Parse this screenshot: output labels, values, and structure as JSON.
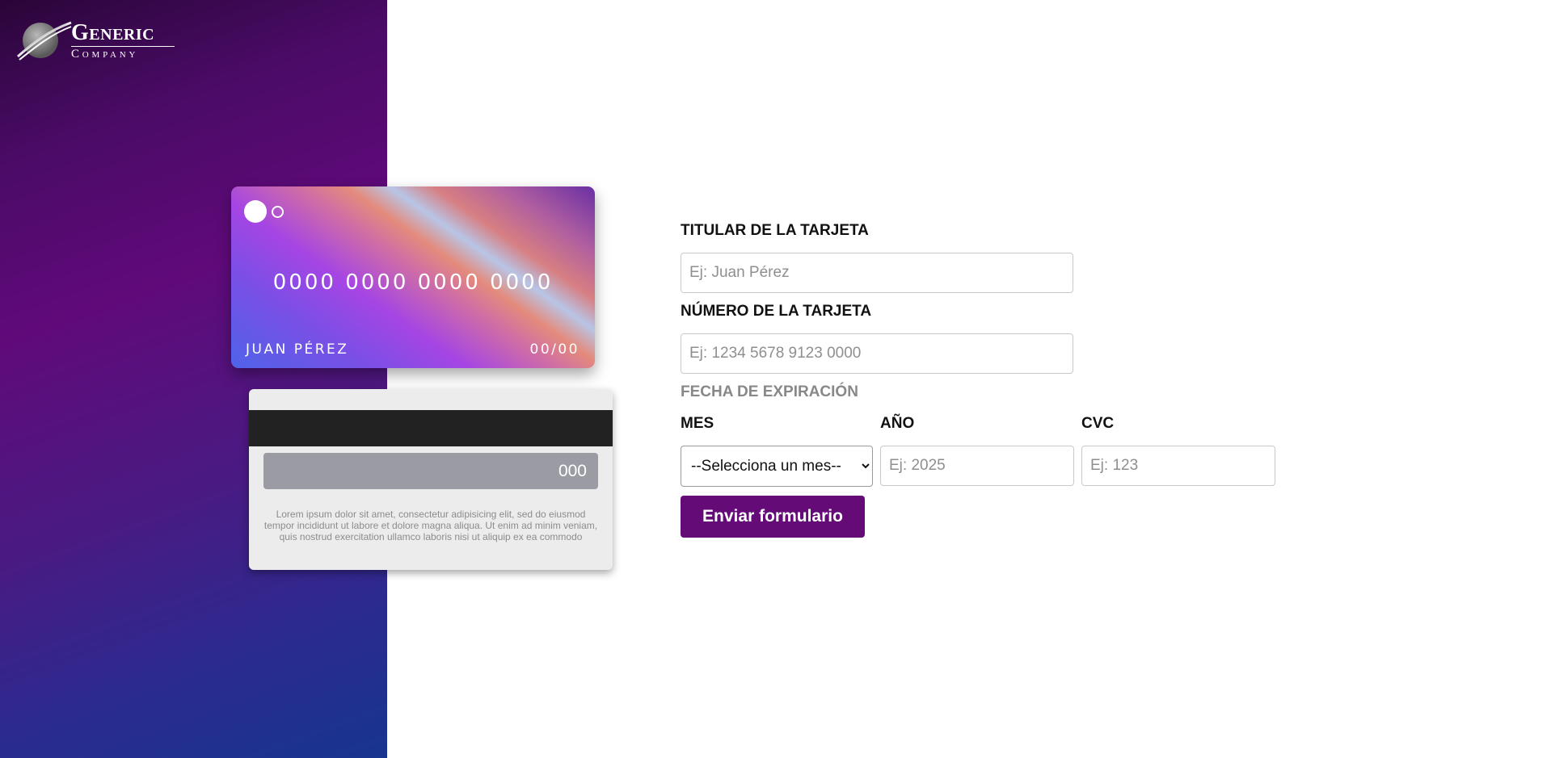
{
  "brand": {
    "logo_line1": "Generic",
    "logo_line2": "Company"
  },
  "card_front": {
    "number": "0000 0000 0000 0000",
    "holder": "JUAN PÉREZ",
    "expiry": "00/00"
  },
  "card_back": {
    "cvc": "000",
    "text": "Lorem ipsum dolor sit amet, consectetur adipisicing elit, sed do eiusmod tempor incididunt ut labore et dolore magna aliqua. Ut enim ad minim veniam, quis nostrud exercitation ullamco laboris nisi ut aliquip ex ea commodo"
  },
  "form": {
    "holder_label": "TITULAR DE LA TARJETA",
    "holder_placeholder": "Ej: Juan Pérez",
    "number_label": "NÚMERO DE LA TARJETA",
    "number_placeholder": "Ej: 1234 5678 9123 0000",
    "expiry_label": "FECHA DE EXPIRACIÓN",
    "month_label": "MES",
    "month_selected": "--Selecciona un mes--",
    "year_label": "AÑO",
    "year_placeholder": "Ej: 2025",
    "cvc_label": "CVC",
    "cvc_placeholder": "Ej: 123",
    "submit_label": "Enviar formulario"
  },
  "colors": {
    "brand_purple": "#650b78",
    "sidebar_gradient_top": "#2a0538",
    "sidebar_gradient_bottom": "#17358f"
  },
  "icons": {
    "logo": "swoosh-globe-icon",
    "select_caret": "chevron-down-icon"
  }
}
